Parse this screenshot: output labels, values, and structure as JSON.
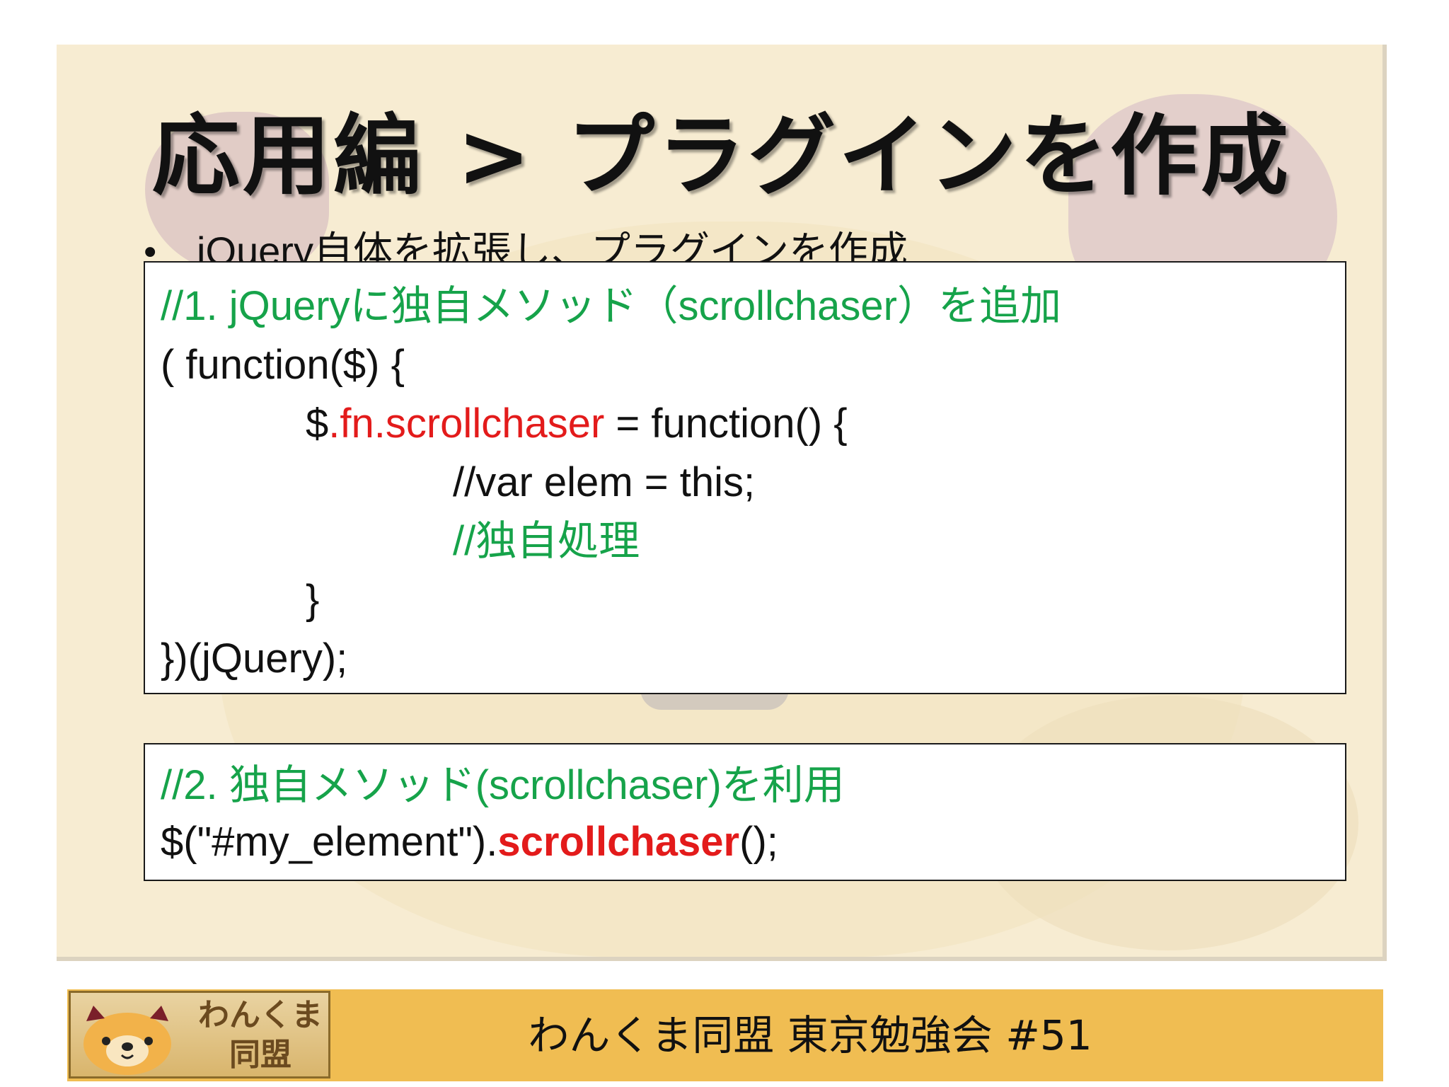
{
  "slide": {
    "title": "応用編 > プラグインを作成",
    "bullet": {
      "marker": "•",
      "text": "jQuery自体を拡張し、プラグインを作成"
    },
    "code_block_1": {
      "comment": "//1. jQueryに独自メソッド（scrollchaser）を追加",
      "line2": "( function($) {",
      "line3_dollar": "$",
      "line3_red": ".fn.scrollchaser",
      "line3_rest": " = function() {",
      "line4": "//var elem = this;",
      "line5_comment": "//独自処理",
      "line6": "}",
      "line7": "})(jQuery);"
    },
    "code_block_2": {
      "comment": "//2. 独自メソッド(scrollchaser)を利用",
      "call_prefix": "$(\"#my_element\").",
      "call_method": "scrollchaser",
      "call_suffix": "();"
    }
  },
  "footer": {
    "logo_text_top": "わんくま",
    "logo_text_bottom": "同盟",
    "text": "わんくま同盟 東京勉強会 #51"
  },
  "colors": {
    "comment": "#16a34a",
    "highlight": "#e31b1b",
    "slide_bg": "#f7ecd2",
    "footer_bg": "#f0bd52"
  }
}
